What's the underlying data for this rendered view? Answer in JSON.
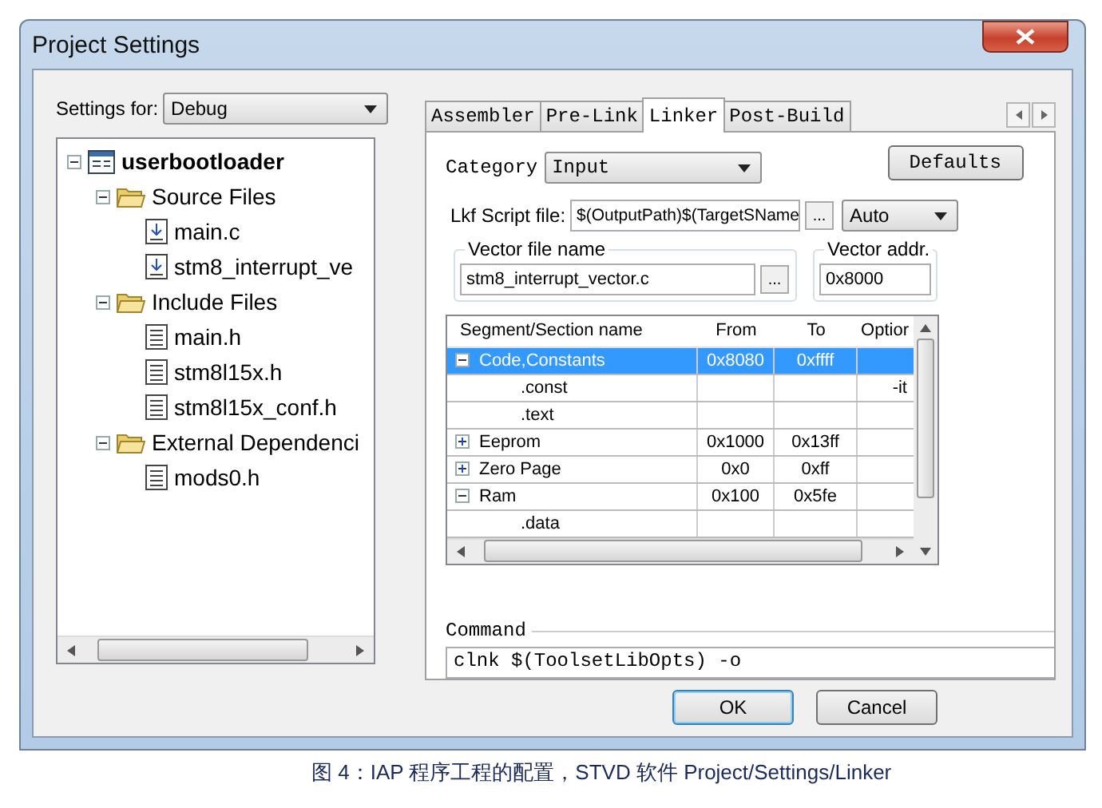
{
  "window": {
    "title": "Project Settings"
  },
  "settings_for": {
    "label": "Settings for:",
    "value": "Debug"
  },
  "tree": [
    {
      "label": "userbootloader",
      "kind": "project",
      "expanded": true,
      "children": [
        {
          "label": "Source Files",
          "kind": "folder",
          "expanded": true,
          "children": [
            {
              "label": "main.c",
              "kind": "source"
            },
            {
              "label": "stm8_interrupt_ve",
              "kind": "source"
            }
          ]
        },
        {
          "label": "Include Files",
          "kind": "folder",
          "expanded": true,
          "children": [
            {
              "label": "main.h",
              "kind": "header"
            },
            {
              "label": "stm8l15x.h",
              "kind": "header"
            },
            {
              "label": "stm8l15x_conf.h",
              "kind": "header"
            }
          ]
        },
        {
          "label": "External Dependenci",
          "kind": "folder",
          "expanded": true,
          "children": [
            {
              "label": "mods0.h",
              "kind": "header"
            }
          ]
        }
      ]
    }
  ],
  "tabs": [
    {
      "label": "Assembler",
      "selected": false
    },
    {
      "label": "Pre-Link",
      "selected": false
    },
    {
      "label": "Linker",
      "selected": true
    },
    {
      "label": "Post-Build",
      "selected": false
    }
  ],
  "category": {
    "label": "Category",
    "value": "Input"
  },
  "defaults_button": "Defaults",
  "lkf_script": {
    "label": "Lkf Script file:",
    "value": "$(OutputPath)$(TargetSName",
    "browse": "...",
    "mode": "Auto"
  },
  "vector_file": {
    "label": "Vector file name",
    "value": "stm8_interrupt_vector.c",
    "browse": "..."
  },
  "vector_addr": {
    "label": "Vector addr.",
    "value": "0x8000"
  },
  "table": {
    "columns": [
      "Segment/Section name",
      "From",
      "To",
      "Optior"
    ],
    "rows": [
      {
        "kind": "group",
        "name": "Code,Constants",
        "from": "0x8080",
        "to": "0xffff",
        "expanded": true,
        "selected": true
      },
      {
        "kind": "section",
        "name": ".const",
        "options": "-it",
        "selected": false
      },
      {
        "kind": "section",
        "name": ".text",
        "selected": false
      },
      {
        "kind": "group",
        "name": "Eeprom",
        "from": "0x1000",
        "to": "0x13ff",
        "expanded": false,
        "selected": false
      },
      {
        "kind": "group",
        "name": "Zero Page",
        "from": "0x0",
        "to": "0xff",
        "expanded": false,
        "selected": false
      },
      {
        "kind": "group",
        "name": "Ram",
        "from": "0x100",
        "to": "0x5fe",
        "expanded": true,
        "selected": false
      },
      {
        "kind": "section",
        "name": ".data",
        "selected": false
      }
    ]
  },
  "command": {
    "label": "Command",
    "value": "clnk $(ToolsetLibOpts) -o"
  },
  "buttons": [
    {
      "label": "OK",
      "default": true
    },
    {
      "label": "Cancel",
      "default": false
    }
  ],
  "caption": "图 4：IAP 程序工程的配置，STVD 软件 Project/Settings/Linker"
}
